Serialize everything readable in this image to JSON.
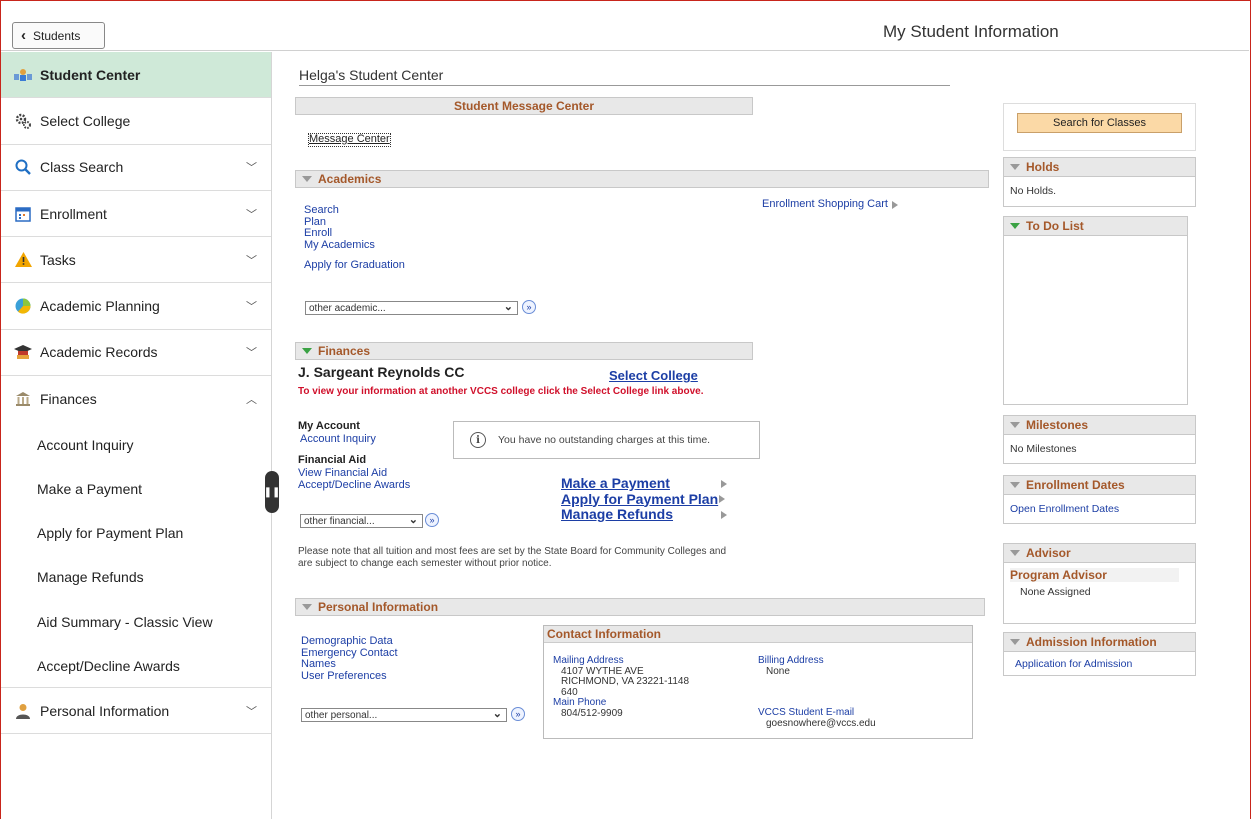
{
  "header": {
    "back_label": "Students",
    "title": "My Student Information"
  },
  "sidebar": {
    "items": [
      {
        "label": "Student Center",
        "icon": "student-center-icon"
      },
      {
        "label": "Select College",
        "icon": "gears-icon"
      },
      {
        "label": "Class Search",
        "icon": "search-icon"
      },
      {
        "label": "Enrollment",
        "icon": "calendar-icon"
      },
      {
        "label": "Tasks",
        "icon": "warning-icon"
      },
      {
        "label": "Academic Planning",
        "icon": "pie-icon"
      },
      {
        "label": "Academic Records",
        "icon": "graduation-cap-icon"
      },
      {
        "label": "Finances",
        "icon": "bank-icon"
      }
    ],
    "finance_sub": [
      "Account Inquiry",
      "Make a Payment",
      "Apply for Payment Plan",
      "Manage Refunds",
      "Aid Summary - Classic View",
      "Accept/Decline Awards"
    ],
    "last_item": {
      "label": "Personal Information",
      "icon": "person-icon"
    }
  },
  "main": {
    "center_title": "Helga's Student Center",
    "message_center": {
      "header": "Student Message Center",
      "link": "Message Center"
    },
    "academics": {
      "header": "Academics",
      "links": [
        "Search",
        "Plan",
        "Enroll",
        "My Academics"
      ],
      "graduation": "Apply for Graduation",
      "shopping_cart": "Enrollment Shopping Cart",
      "select": "other academic..."
    },
    "finances": {
      "header": "Finances",
      "college": "J. Sargeant Reynolds CC",
      "select_college": "Select College",
      "notice": "To view your information at another VCCS college click the Select College link above.",
      "my_account": "My Account",
      "account_inquiry": "Account Inquiry",
      "financial_aid": "Financial Aid",
      "view_aid": "View Financial Aid",
      "accept_awards": "Accept/Decline Awards",
      "charges_msg": "You have no outstanding charges at this time.",
      "make_payment": "Make a Payment",
      "payment_plan": "Apply for Payment Plan",
      "manage_refunds": "Manage Refunds",
      "select": "other financial...",
      "note": "Please note that all tuition and most fees are set by the State Board for Community Colleges and are subject to change each semester without prior notice."
    },
    "personal": {
      "header": "Personal Information",
      "links": [
        "Demographic Data",
        "Emergency Contact",
        "Names",
        "User Preferences"
      ],
      "select": "other personal...",
      "contact": {
        "header": "Contact Information",
        "mailing_label": "Mailing Address",
        "mailing_line1": "4107 WYTHE AVE",
        "mailing_line2": "RICHMOND, VA 23221-1148",
        "mailing_line3": "640",
        "billing_label": "Billing Address",
        "billing_value": "None",
        "phone_label": "Main Phone",
        "phone_value": "804/512-9909",
        "email_label": "VCCS Student E-mail",
        "email_value": "goesnowhere@vccs.edu"
      }
    }
  },
  "right": {
    "search_button": "Search for Classes",
    "holds": {
      "header": "Holds",
      "body": "No Holds."
    },
    "todo": {
      "header": "To Do List"
    },
    "milestones": {
      "header": "Milestones",
      "body": "No Milestones"
    },
    "enrollment_dates": {
      "header": "Enrollment Dates",
      "link": "Open Enrollment Dates"
    },
    "advisor": {
      "header": "Advisor",
      "sub": "Program Advisor",
      "body": "None Assigned"
    },
    "admission": {
      "header": "Admission Information",
      "link": "Application for Admission"
    }
  }
}
